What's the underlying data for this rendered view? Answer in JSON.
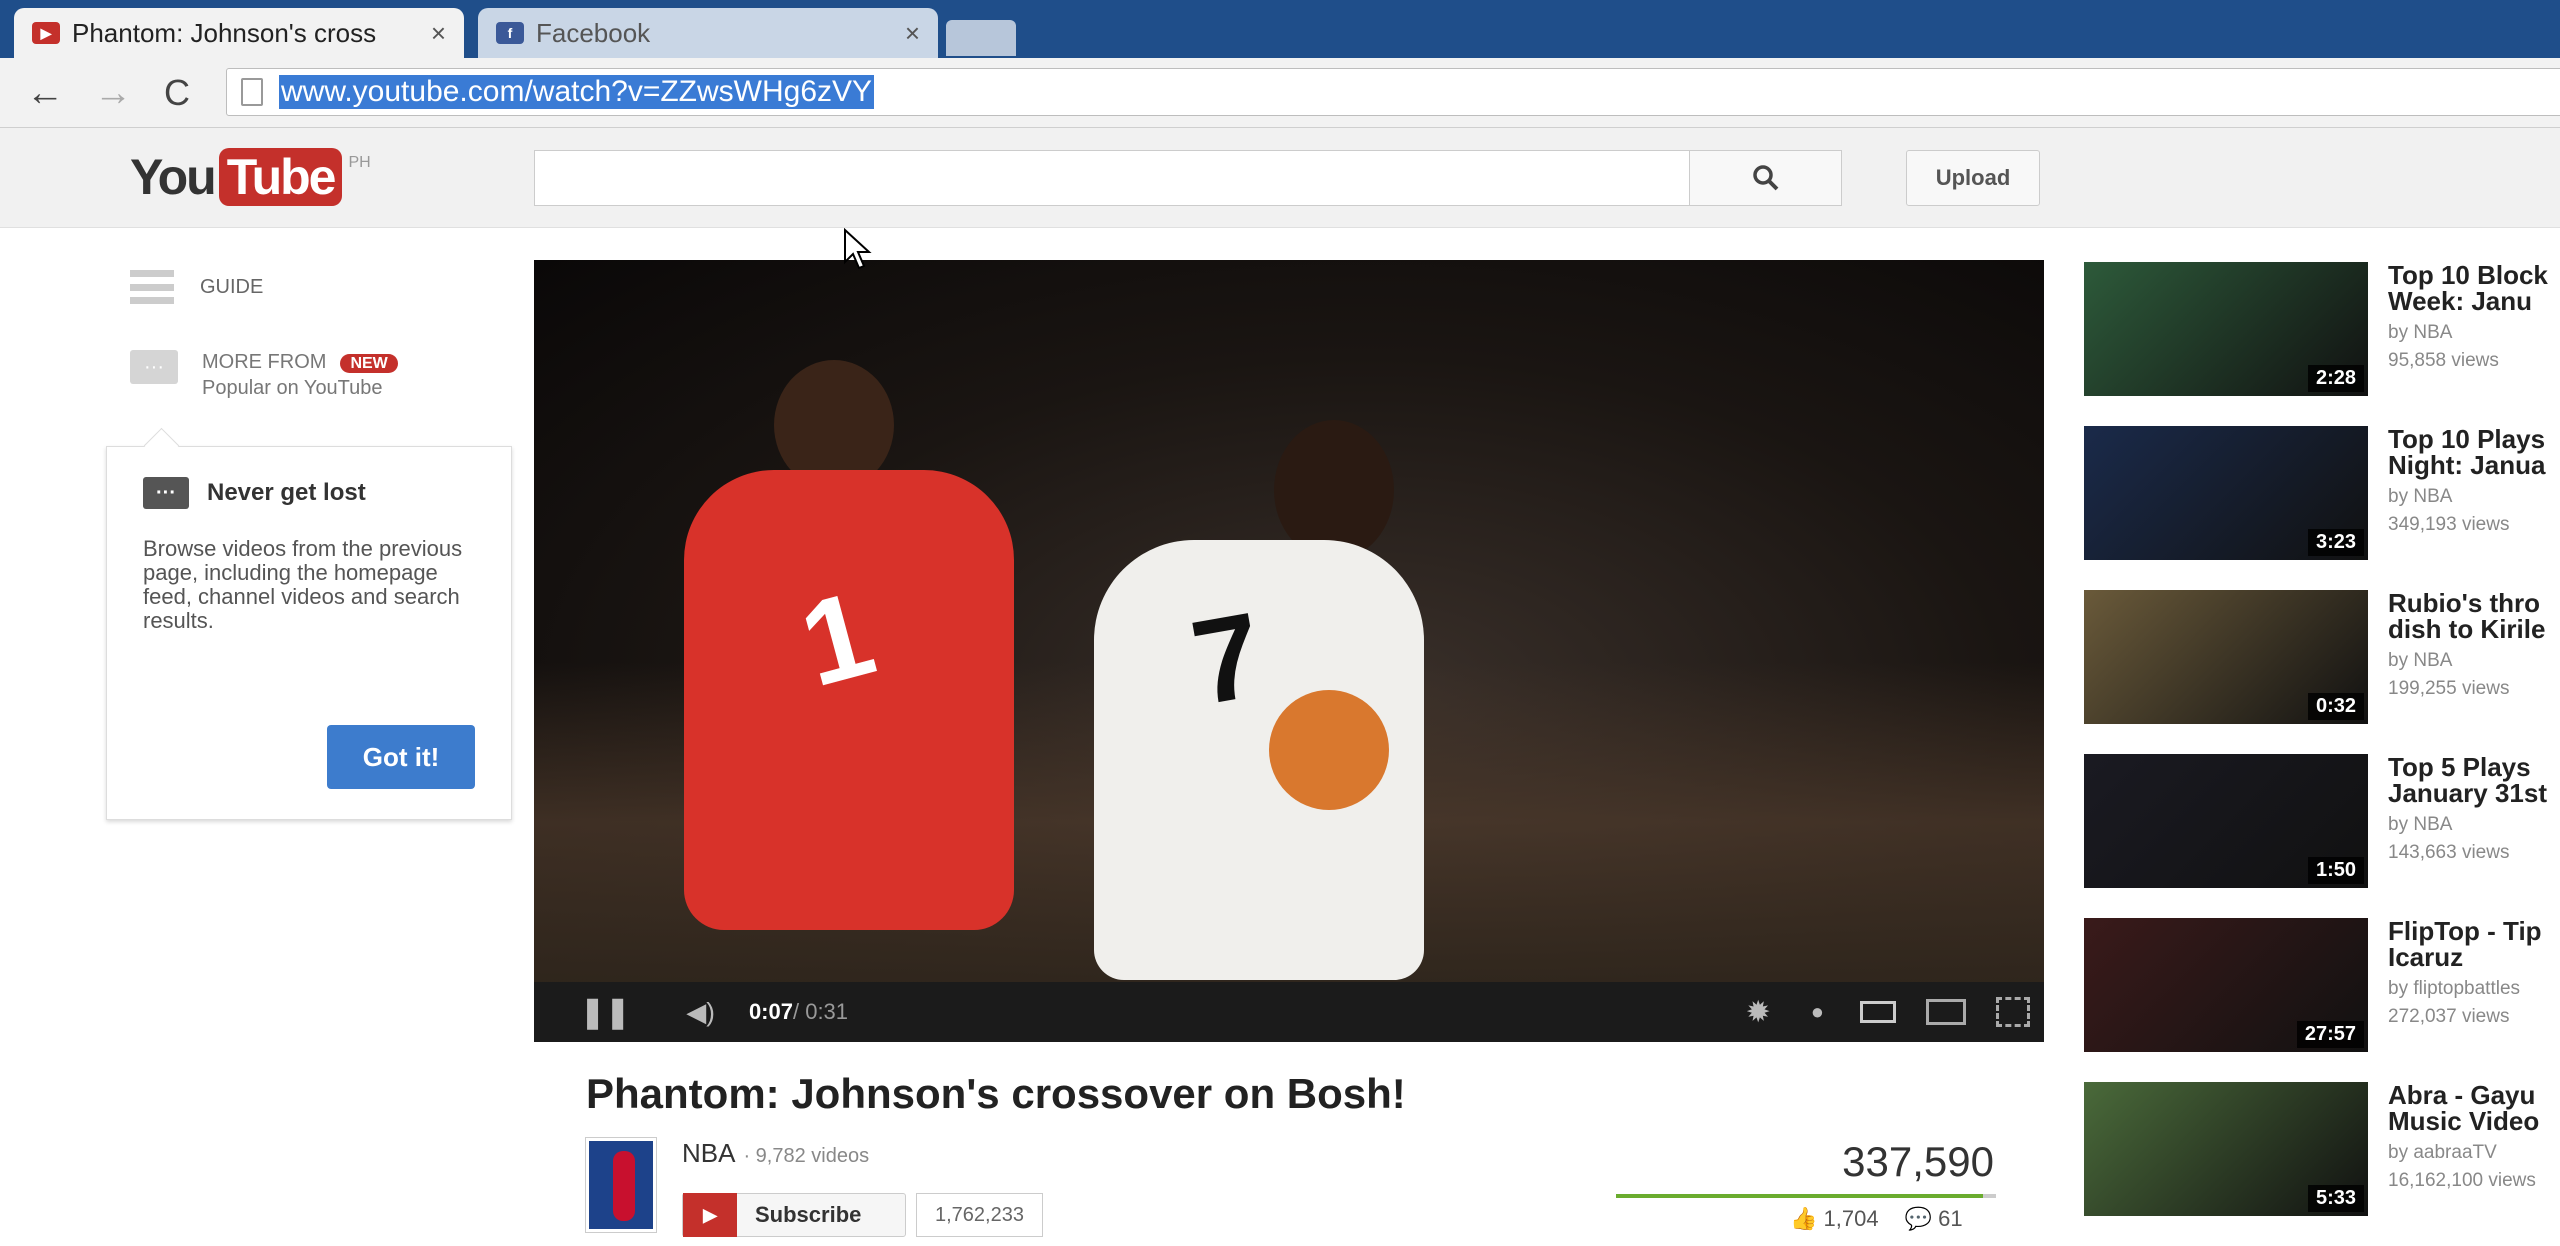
{
  "browser": {
    "tabs": [
      {
        "title": "Phantom: Johnson's cross",
        "active": true,
        "icon": "youtube-icon"
      },
      {
        "title": "Facebook",
        "active": false,
        "icon": "facebook-icon"
      }
    ],
    "close_glyph": "×",
    "url": "www.youtube.com/watch?v=ZZwsWHg6zVY"
  },
  "header": {
    "logo_you": "You",
    "logo_tube": "Tube",
    "logo_region": "PH",
    "search_placeholder": "",
    "upload_label": "Upload"
  },
  "guide": {
    "guide_label": "GUIDE",
    "more_from_label": "MORE FROM",
    "new_badge": "NEW",
    "popular_label": "Popular on YouTube"
  },
  "popup": {
    "title": "Never get lost",
    "body": "Browse videos from the previous page, including the homepage feed, channel videos and search results.",
    "button": "Got it!"
  },
  "player": {
    "current_time": "0:07",
    "duration": " / 0:31",
    "progress_fraction": 0.226,
    "buffered_fraction": 0.26,
    "jersey_red": "1",
    "jersey_white": "7"
  },
  "video": {
    "title": "Phantom: Johnson's crossover on Bosh!",
    "channel": "NBA",
    "channel_videos": "· 9,782 videos",
    "subscribe_label": "Subscribe",
    "subscriber_count": "1,762,233",
    "views": "337,590",
    "likes": "1,704",
    "dislikes": "61",
    "like_fraction": 0.965
  },
  "related": [
    {
      "title1": "Top 10 Block",
      "title2": "Week: Janu",
      "by": "by NBA",
      "views": "95,858 views",
      "duration": "2:28",
      "color": "#2d5a3a"
    },
    {
      "title1": "Top 10 Plays",
      "title2": "Night: Janua",
      "by": "by NBA",
      "views": "349,193 views",
      "duration": "3:23",
      "color": "#1a2a4a"
    },
    {
      "title1": "Rubio's thro",
      "title2": "dish to Kirile",
      "by": "by NBA",
      "views": "199,255 views",
      "duration": "0:32",
      "color": "#6a5a3a"
    },
    {
      "title1": "Top 5 Plays",
      "title2": "January 31st",
      "by": "by NBA",
      "views": "143,663 views",
      "duration": "1:50",
      "color": "#1a1a22"
    },
    {
      "title1": "FlipTop - Tip",
      "title2": "Icaruz",
      "by": "by fliptopbattles",
      "views": "272,037 views",
      "duration": "27:57",
      "color": "#3a1a1a"
    },
    {
      "title1": "Abra - Gayu",
      "title2": "Music Video",
      "by": "by aabraaTV",
      "views": "16,162,100 views",
      "duration": "5:33",
      "color": "#4a6a3a"
    }
  ]
}
